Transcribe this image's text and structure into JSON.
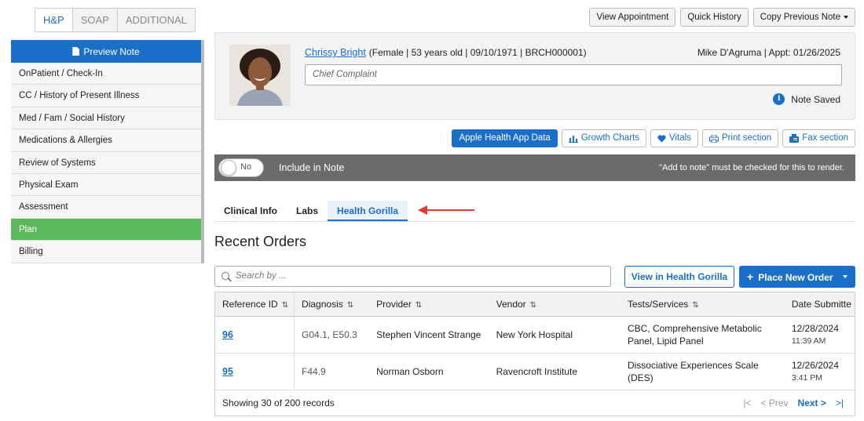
{
  "mode_tabs": [
    {
      "label": "H&P",
      "active": true
    },
    {
      "label": "SOAP",
      "active": false
    },
    {
      "label": "ADDITIONAL",
      "active": false
    }
  ],
  "sidebar": {
    "preview_label": "Preview Note",
    "items": [
      {
        "label": "OnPatient / Check-In",
        "active": false
      },
      {
        "label": "CC / History of Present Illness",
        "active": false
      },
      {
        "label": "Med / Fam / Social History",
        "active": false
      },
      {
        "label": "Medications & Allergies",
        "active": false
      },
      {
        "label": "Review of Systems",
        "active": false
      },
      {
        "label": "Physical Exam",
        "active": false
      },
      {
        "label": "Assessment",
        "active": false
      },
      {
        "label": "Plan",
        "active": true
      },
      {
        "label": "Billing",
        "active": false
      }
    ]
  },
  "top_buttons": {
    "view_appointment": "View Appointment",
    "quick_history": "Quick History",
    "copy_previous": "Copy Previous Note"
  },
  "patient": {
    "name": "Chrissy Bright",
    "details": "(Female | 53 years old | 09/10/1971 | BRCH000001)",
    "provider_appt": "Mike D'Agruma | Appt: 01/26/2025",
    "chief_complaint_placeholder": "Chief Complaint",
    "saved_status": "Note Saved"
  },
  "actions": {
    "apple_health": "Apple Health App Data",
    "growth_charts": "Growth Charts",
    "vitals": "Vitals",
    "print_section": "Print section",
    "fax_section": "Fax section"
  },
  "include_bar": {
    "toggle_label": "No",
    "label": "Include in Note",
    "note": "\"Add to note\" must be checked for this to render."
  },
  "sub_tabs": [
    {
      "label": "Clinical Info",
      "active": false
    },
    {
      "label": "Labs",
      "active": false
    },
    {
      "label": "Health Gorilla",
      "active": true
    }
  ],
  "recent_orders": {
    "title": "Recent Orders",
    "search_placeholder": "Search by ...",
    "view_hg_button": "View in Health Gorilla",
    "place_order_button": "Place New Order",
    "columns": [
      "Reference ID",
      "Diagnosis",
      "Provider",
      "Vendor",
      "Tests/Services",
      "Date Submitte"
    ],
    "rows": [
      {
        "ref": "96",
        "diagnosis": "G04.1, E50.3",
        "provider": "Stephen Vincent Strange",
        "vendor": "New York Hospital",
        "tests": "CBC, Comprehensive Metabolic Panel, Lipid Panel",
        "date": "12/28/2024",
        "time": "11:39 AM"
      },
      {
        "ref": "95",
        "diagnosis": "F44.9",
        "provider": "Norman Osborn",
        "vendor": "Ravencroft Institute",
        "tests": "Dissociative Experiences Scale (DES)",
        "date": "12/26/2024",
        "time": "3:41 PM"
      }
    ],
    "footer": "Showing 30 of 200 records",
    "pager": {
      "first": "|<",
      "prev": "< Prev",
      "next": "Next >",
      "last": ">|"
    }
  },
  "colors": {
    "accent": "#1a6fc9",
    "active_nav": "#5cb85c",
    "bar": "#6b6b6b",
    "arrow": "#e53935"
  }
}
